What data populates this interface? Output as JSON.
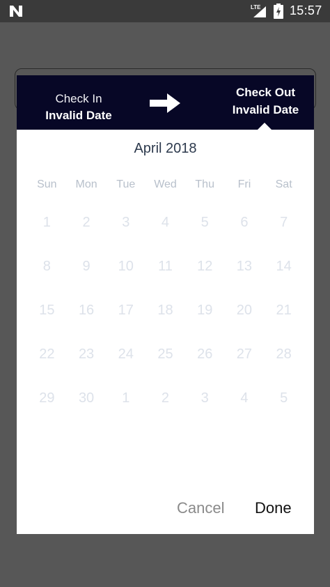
{
  "status_bar": {
    "time": "15:57",
    "network": "LTE",
    "icons": [
      "n-logo-icon",
      "signal-icon",
      "battery-charging-icon"
    ]
  },
  "header": {
    "check_in_label": "Check In",
    "check_in_value": "Invalid Date",
    "check_out_label": "Check Out",
    "check_out_value": "Invalid Date",
    "arrow_icon": "arrow-right-icon",
    "background_color": "#070726"
  },
  "calendar": {
    "month_title": "April 2018",
    "weekdays": [
      "Sun",
      "Mon",
      "Tue",
      "Wed",
      "Thu",
      "Fri",
      "Sat"
    ],
    "days": [
      "1",
      "2",
      "3",
      "4",
      "5",
      "6",
      "7",
      "8",
      "9",
      "10",
      "11",
      "12",
      "13",
      "14",
      "15",
      "16",
      "17",
      "18",
      "19",
      "20",
      "21",
      "22",
      "23",
      "24",
      "25",
      "26",
      "27",
      "28",
      "29",
      "30",
      "1",
      "2",
      "3",
      "4",
      "5"
    ]
  },
  "actions": {
    "cancel_label": "Cancel",
    "done_label": "Done"
  }
}
